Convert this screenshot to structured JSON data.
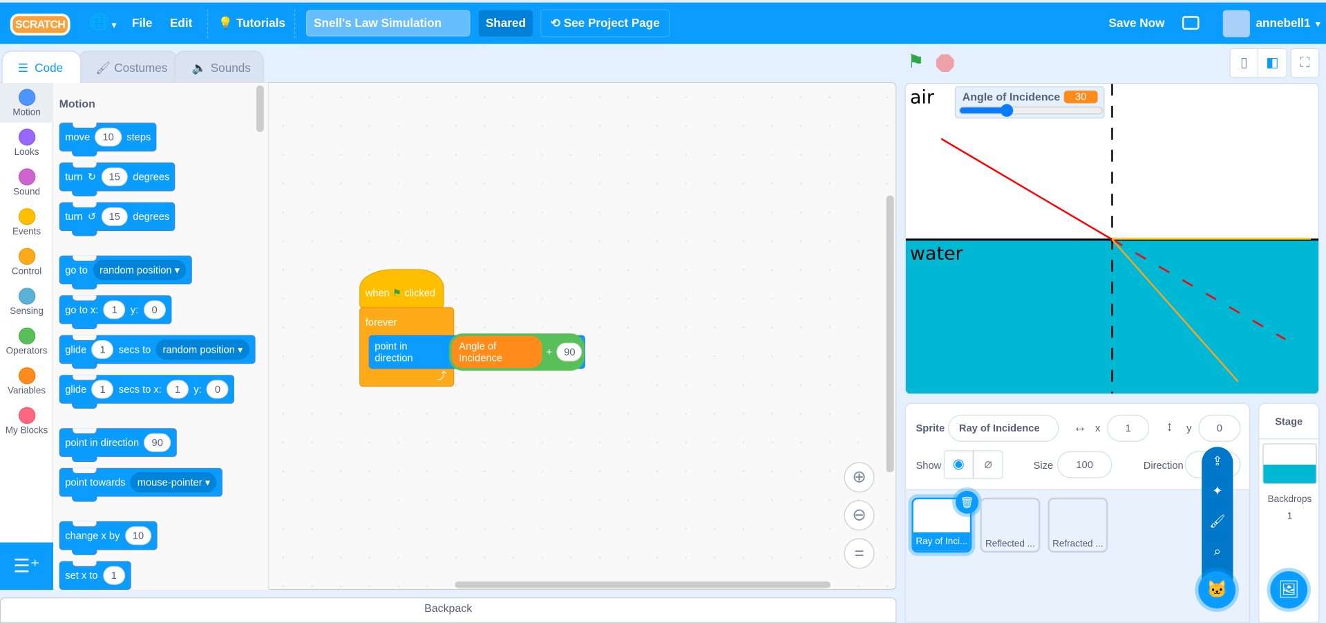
{
  "menu": {
    "logo": "SCRATCH",
    "file": "File",
    "edit": "Edit",
    "tutorials": "Tutorials",
    "project_title": "Snell's Law Simulation",
    "shared": "Shared",
    "see_project_page": "See Project Page",
    "save_now": "Save Now",
    "username": "annebell1"
  },
  "tabs": [
    {
      "label": "Code"
    },
    {
      "label": "Costumes"
    },
    {
      "label": "Sounds"
    }
  ],
  "categories": [
    {
      "label": "Motion",
      "color": "#4c97ff"
    },
    {
      "label": "Looks",
      "color": "#9966ff"
    },
    {
      "label": "Sound",
      "color": "#cf63cf"
    },
    {
      "label": "Events",
      "color": "#ffbf00"
    },
    {
      "label": "Control",
      "color": "#ffab19"
    },
    {
      "label": "Sensing",
      "color": "#5cb1d6"
    },
    {
      "label": "Operators",
      "color": "#59c059"
    },
    {
      "label": "Variables",
      "color": "#ff8c1a"
    },
    {
      "label": "My Blocks",
      "color": "#ff6680"
    }
  ],
  "palette": {
    "heading": "Motion",
    "move": {
      "a": "move",
      "v": "10",
      "b": "steps"
    },
    "turn_right": {
      "a": "turn",
      "v": "15",
      "b": "degrees"
    },
    "turn_left": {
      "a": "turn",
      "v": "15",
      "b": "degrees"
    },
    "goto": {
      "a": "go to",
      "d": "random position"
    },
    "gotoxy": {
      "a": "go to x:",
      "x": "1",
      "b": "y:",
      "y": "0"
    },
    "glide": {
      "a": "glide",
      "v": "1",
      "b": "secs to",
      "d": "random position"
    },
    "glidexy": {
      "a": "glide",
      "v": "1",
      "b": "secs to x:",
      "x": "1",
      "c": "y:",
      "y": "0"
    },
    "point": {
      "a": "point in direction",
      "v": "90"
    },
    "towards": {
      "a": "point towards",
      "d": "mouse-pointer"
    },
    "changex": {
      "a": "change x by",
      "v": "10"
    },
    "setx": {
      "a": "set x to",
      "v": "1"
    }
  },
  "script": {
    "when": "when",
    "clicked": "clicked",
    "forever": "forever",
    "point": "point in direction",
    "var": "Angle of Incidence",
    "plus": "+",
    "num": "90"
  },
  "backpack": "Backpack",
  "stage": {
    "air": "air",
    "water": "water",
    "monitor_label": "Angle of Incidence",
    "monitor_value": "30",
    "slider_fraction": 0.33,
    "water_color": "#00b8d4"
  },
  "sprite_info": {
    "sprite_label": "Sprite",
    "sprite_name": "Ray of Incidence",
    "x_label": "x",
    "x": "1",
    "y_label": "y",
    "y": "0",
    "show_label": "Show",
    "size_label": "Size",
    "size": "100",
    "direction_label": "Direction"
  },
  "sprites": [
    {
      "name": "Ray of Inci..."
    },
    {
      "name": "Reflected ..."
    },
    {
      "name": "Refracted ..."
    }
  ],
  "stage_pane": {
    "title": "Stage",
    "backdrops_label": "Backdrops",
    "backdrops_count": "1"
  }
}
